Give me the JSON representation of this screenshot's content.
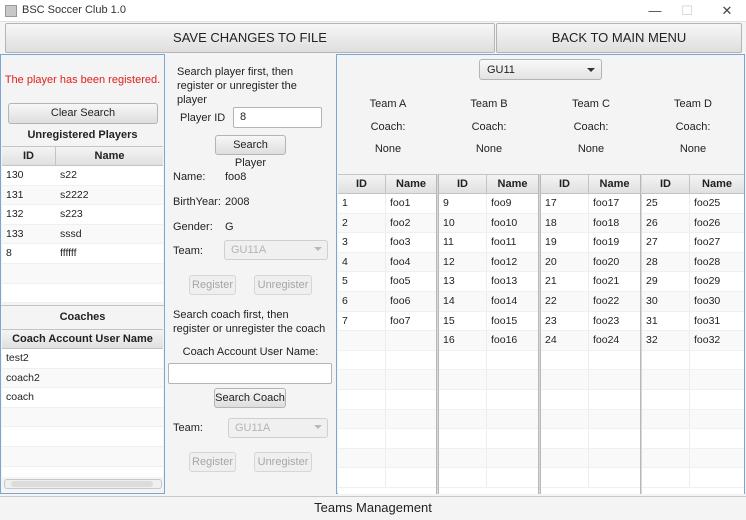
{
  "window": {
    "title": "BSC Soccer Club 1.0",
    "minimize": "—",
    "maximize": "☐",
    "close": "✕"
  },
  "toolbar": {
    "save_label": "SAVE CHANGES TO FILE",
    "back_label": "BACK TO MAIN MENU"
  },
  "left": {
    "message": "The player has been registered.",
    "clear_label": "Clear Search",
    "unregistered_title": "Unregistered Players",
    "players_columns": [
      "ID",
      "Name"
    ],
    "players": [
      {
        "id": "130",
        "name": "s22"
      },
      {
        "id": "131",
        "name": "s2222"
      },
      {
        "id": "132",
        "name": "s223"
      },
      {
        "id": "133",
        "name": "sssd"
      },
      {
        "id": "8",
        "name": "ffffff"
      }
    ],
    "coaches_title": "Coaches",
    "coaches_column": "Coach Account User Name",
    "coaches": [
      "test2",
      "coach2",
      "coach"
    ]
  },
  "middle": {
    "player_hint": "Search player first, then register or unregister the player",
    "player_id_label": "Player ID",
    "player_id_value": "8",
    "search_player_label": "Search Player",
    "name_label": "Name:",
    "name_value": "foo8",
    "birth_label": "BirthYear:",
    "birth_value": "2008",
    "gender_label": "Gender:",
    "gender_value": "G",
    "team_label": "Team:",
    "team_value": "GU11A",
    "register_label": "Register",
    "unregister_label": "Unregister",
    "coach_hint": "Search coach first, then register or unregister the coach",
    "coach_user_label": "Coach Account User Name:",
    "coach_user_value": "",
    "search_coach_label": "Search Coach",
    "coach_team_label": "Team:",
    "coach_team_value": "GU11A",
    "coach_register_label": "Register",
    "coach_unregister_label": "Unregister"
  },
  "right": {
    "division": "GU11",
    "teams": [
      {
        "name": "Team A",
        "coach_label": "Coach:",
        "coach": "None"
      },
      {
        "name": "Team B",
        "coach_label": "Coach:",
        "coach": "None"
      },
      {
        "name": "Team C",
        "coach_label": "Coach:",
        "coach": "None"
      },
      {
        "name": "Team D",
        "coach_label": "Coach:",
        "coach": "None"
      }
    ],
    "columns": [
      "ID",
      "Name"
    ],
    "rosters": [
      [
        [
          "1",
          "foo1"
        ],
        [
          "2",
          "foo2"
        ],
        [
          "3",
          "foo3"
        ],
        [
          "4",
          "foo4"
        ],
        [
          "5",
          "foo5"
        ],
        [
          "6",
          "foo6"
        ],
        [
          "7",
          "foo7"
        ]
      ],
      [
        [
          "9",
          "foo9"
        ],
        [
          "10",
          "foo10"
        ],
        [
          "11",
          "foo11"
        ],
        [
          "12",
          "foo12"
        ],
        [
          "13",
          "foo13"
        ],
        [
          "14",
          "foo14"
        ],
        [
          "15",
          "foo15"
        ],
        [
          "16",
          "foo16"
        ]
      ],
      [
        [
          "17",
          "foo17"
        ],
        [
          "18",
          "foo18"
        ],
        [
          "19",
          "foo19"
        ],
        [
          "20",
          "foo20"
        ],
        [
          "21",
          "foo21"
        ],
        [
          "22",
          "foo22"
        ],
        [
          "23",
          "foo23"
        ],
        [
          "24",
          "foo24"
        ]
      ],
      [
        [
          "25",
          "foo25"
        ],
        [
          "26",
          "foo26"
        ],
        [
          "27",
          "foo27"
        ],
        [
          "28",
          "foo28"
        ],
        [
          "29",
          "foo29"
        ],
        [
          "30",
          "foo30"
        ],
        [
          "31",
          "foo31"
        ],
        [
          "32",
          "foo32"
        ]
      ]
    ]
  },
  "status": "Teams Management",
  "colors": {
    "message": "#e0201c",
    "panel_border": "#7aa6d6"
  }
}
